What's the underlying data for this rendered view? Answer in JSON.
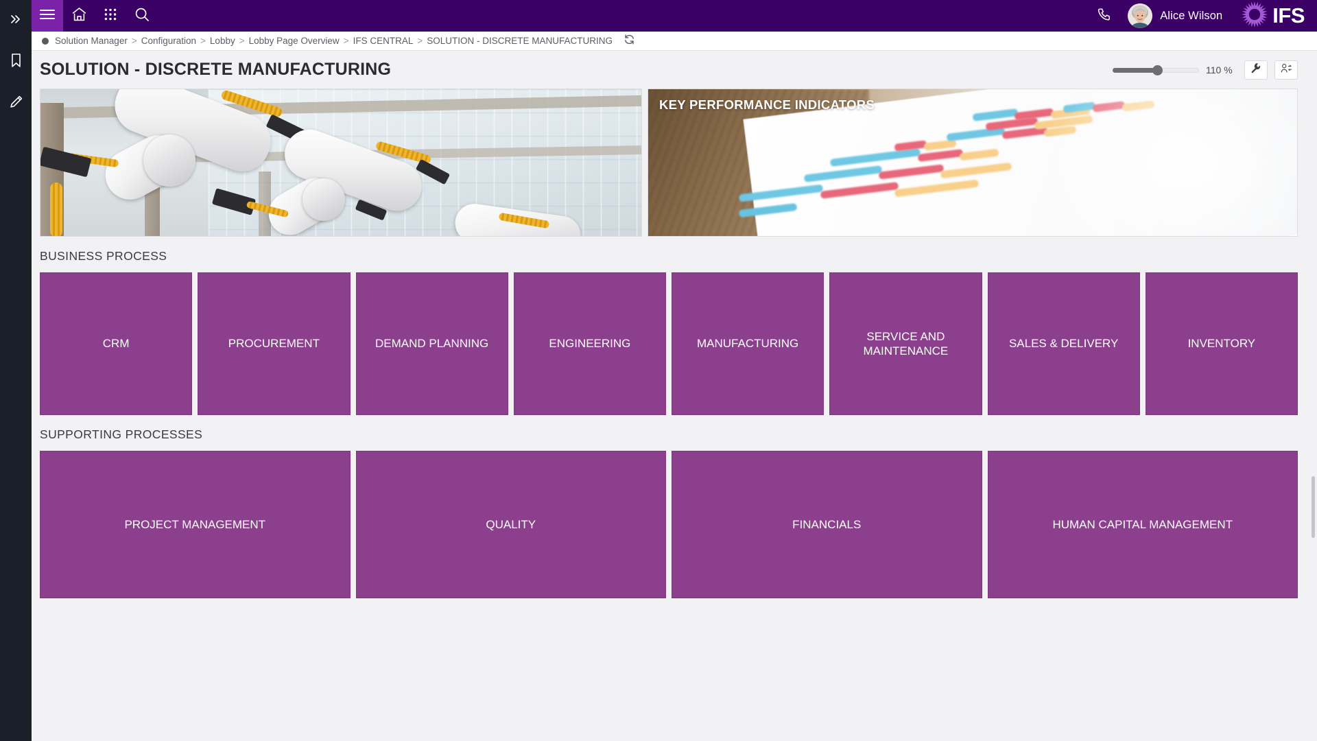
{
  "left_rail": {
    "items": [
      {
        "name": "expand-panel",
        "icon": "double-chevron-right-icon"
      },
      {
        "name": "bookmark",
        "icon": "bookmark-icon"
      },
      {
        "name": "edit",
        "icon": "pencil-icon"
      }
    ]
  },
  "top_bar": {
    "menu_icon": "hamburger-menu-icon",
    "home_icon": "home-icon",
    "apps_icon": "grid-apps-icon",
    "search_icon": "search-icon",
    "phone_icon": "phone-icon",
    "user_name": "Alice Wilson",
    "avatar_icon": "user-avatar",
    "brand": "IFS",
    "brand_logo_icon": "ifs-pinwheel-logo-icon",
    "accent_color": "#3b0066",
    "menu_button_color": "#7b22a8"
  },
  "breadcrumb": {
    "status_icon": "status-dot-icon",
    "separator": ">",
    "items": [
      "Solution Manager",
      "Configuration",
      "Lobby",
      "Lobby Page Overview",
      "IFS CENTRAL",
      "SOLUTION - DISCRETE MANUFACTURING"
    ],
    "refresh_icon": "refresh-icon"
  },
  "page": {
    "title": "SOLUTION - DISCRETE MANUFACTURING",
    "zoom": {
      "value_label": "110 %",
      "percent": 110,
      "min": 50,
      "max": 200
    },
    "tools": [
      {
        "name": "configure-lobby-button",
        "icon": "wrench-icon"
      },
      {
        "name": "switch-user-button",
        "icon": "user-switch-icon"
      }
    ]
  },
  "hero": {
    "robots": {
      "name": "discrete-manufacturing-image",
      "alt": "Industrial robotic arms in a factory",
      "caption": ""
    },
    "kpi": {
      "name": "key-performance-indicators-image",
      "title": "KEY PERFORMANCE INDICATORS",
      "alt": "Printed report with coloured bar charts on a desk"
    }
  },
  "sections": [
    {
      "id": "business-process",
      "title": "BUSINESS PROCESS",
      "tiles": [
        "CRM",
        "PROCUREMENT",
        "DEMAND PLANNING",
        "ENGINEERING",
        "MANUFACTURING",
        "SERVICE AND MAINTENANCE",
        "SALES & DELIVERY",
        "INVENTORY"
      ]
    },
    {
      "id": "supporting-processes",
      "title": "SUPPORTING PROCESSES",
      "tiles": [
        "PROJECT MANAGEMENT",
        "QUALITY",
        "FINANCIALS",
        "HUMAN CAPITAL MANAGEMENT"
      ]
    }
  ],
  "theme": {
    "tile_color": "#8c3f8c",
    "tile_border": "#7d387d",
    "page_background": "#f2f1f4",
    "rail_background": "#1b1f2a",
    "topbar_background": "#3b0066"
  }
}
